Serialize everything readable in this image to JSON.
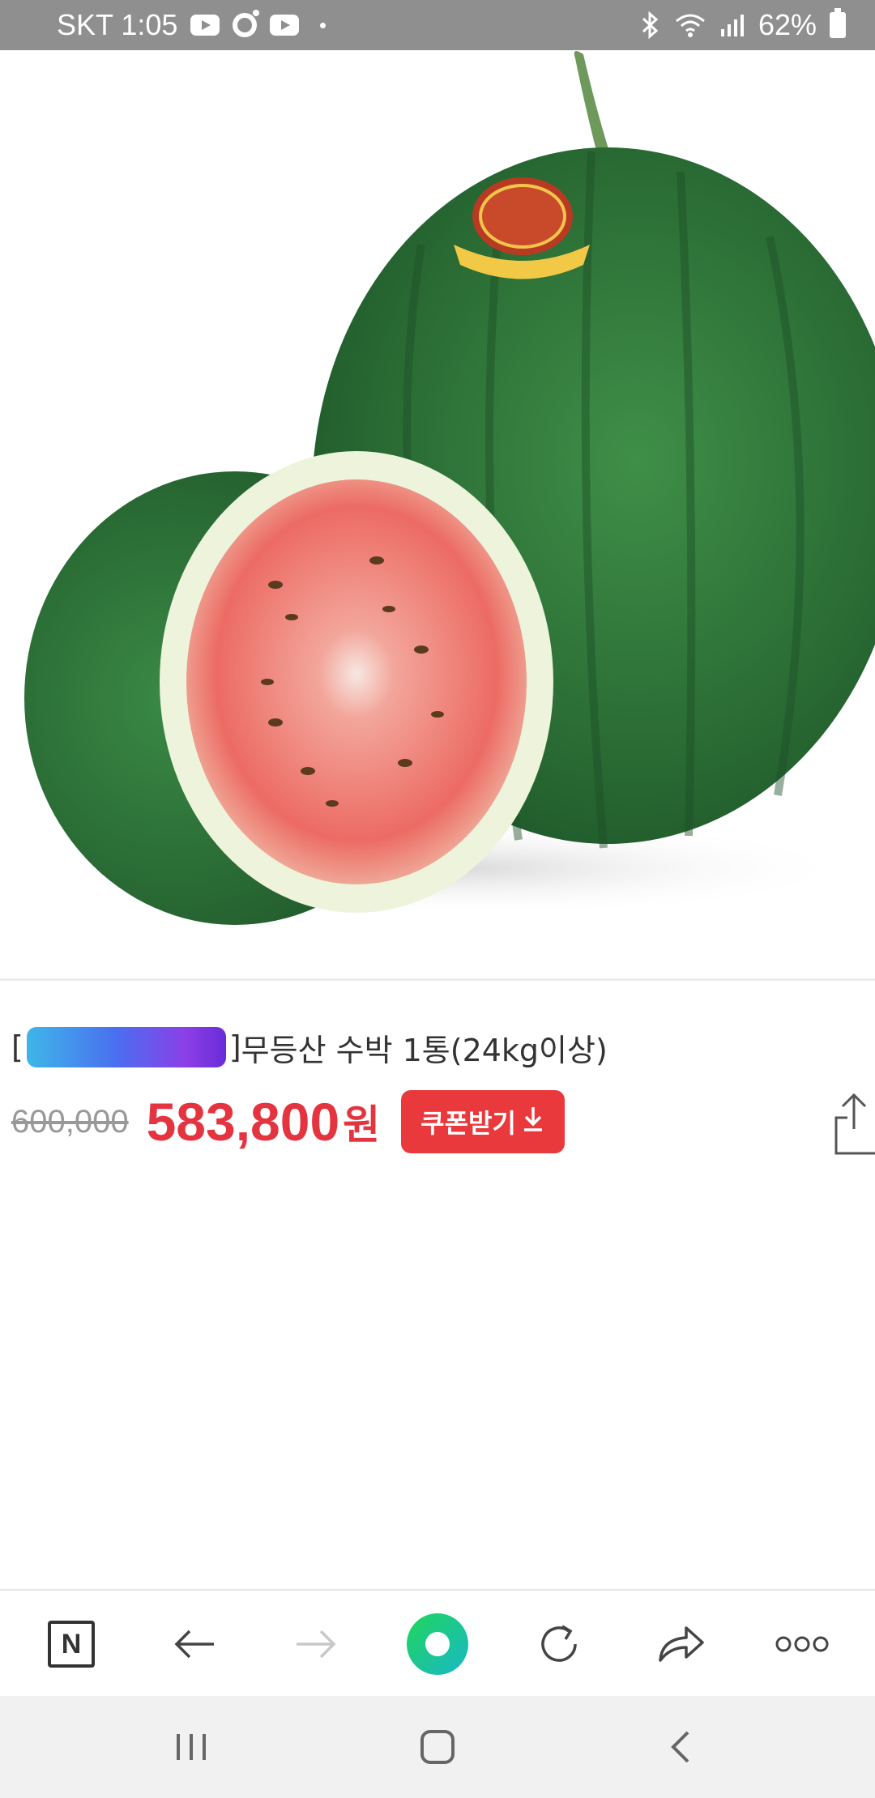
{
  "status_bar": {
    "carrier_time": "SKT 1:05",
    "battery": "62%",
    "icons": [
      "youtube-icon",
      "camera-icon",
      "youtube-icon",
      "dot-icon",
      "bluetooth-icon",
      "wifi-icon",
      "signal-icon",
      "battery-icon"
    ]
  },
  "product": {
    "image_name": "watermelon-product-image",
    "title_bracket_open": "[",
    "title_bracket_close": "]",
    "title": "무등산 수박 1통(24kg이상)",
    "original_price": "600,000",
    "sale_price": "583,800",
    "currency": "원",
    "coupon_label": "쿠폰받기",
    "colors": {
      "sale": "#e43440",
      "coupon_bg": "#e9393d"
    }
  },
  "browser_bar": {
    "n_label": "N",
    "items": [
      "naver-home-icon",
      "back-arrow-icon",
      "forward-arrow-icon",
      "green-home-button",
      "reload-icon",
      "share-icon",
      "more-icon"
    ]
  },
  "nav_bar": {
    "items": [
      "recent-apps-icon",
      "home-icon",
      "back-icon"
    ]
  }
}
